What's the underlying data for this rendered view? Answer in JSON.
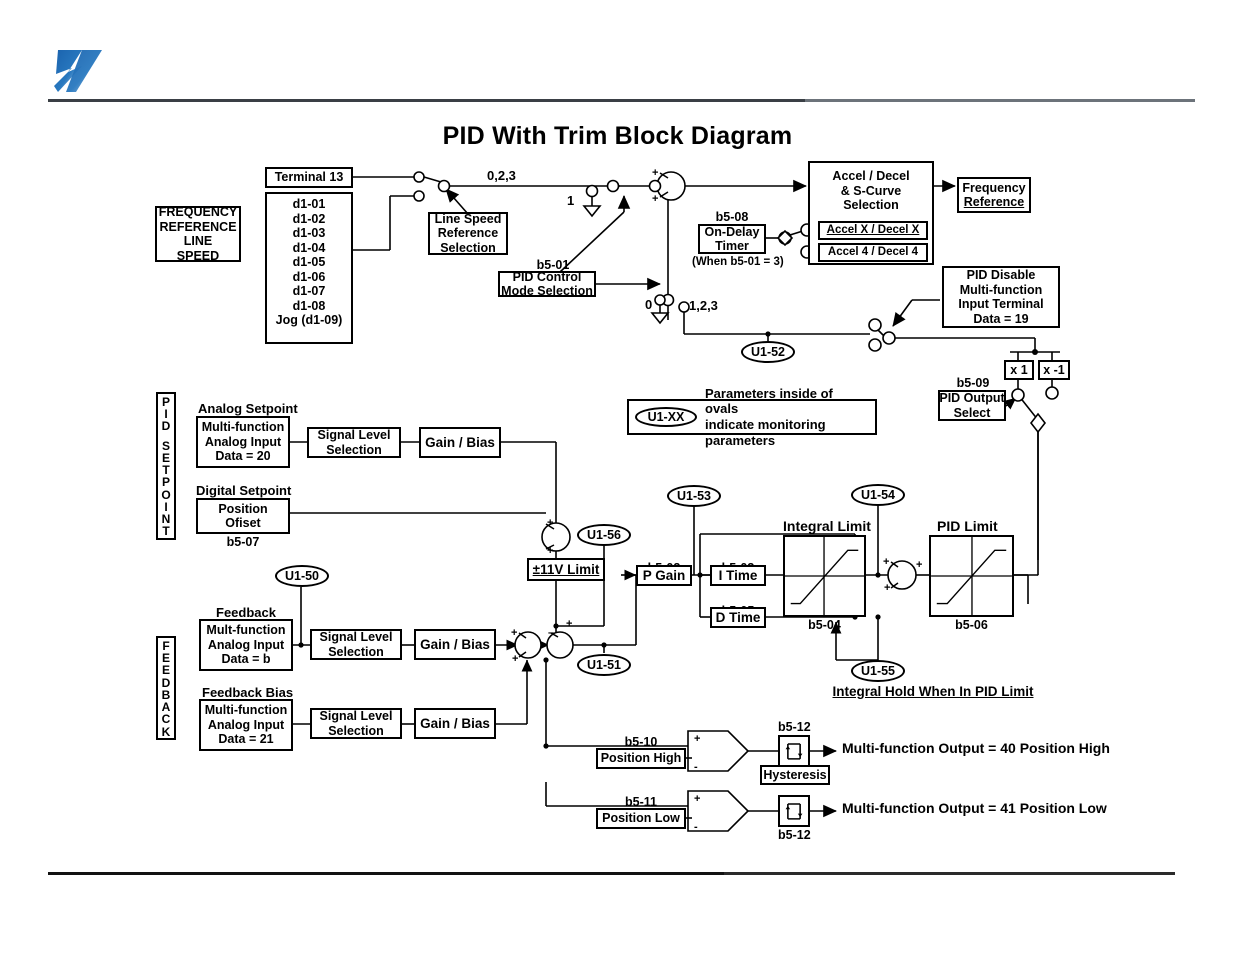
{
  "document": {
    "title": "PID With Trim Block Diagram",
    "logo_alt": "company-logo",
    "logo_color": "#1d6ab5"
  },
  "frequency_reference": {
    "side_label_lines": [
      "FREQUENCY",
      "REFERENCE",
      "LINE",
      "SPEED"
    ],
    "terminal": "Terminal 13",
    "d_params": [
      "d1-01",
      "d1-02",
      "d1-03",
      "d1-04",
      "d1-05",
      "d1-06",
      "d1-07",
      "d1-08",
      "Jog (d1-09)"
    ],
    "line_speed_selection": [
      "Line Speed",
      "Reference",
      "Selection"
    ]
  },
  "pid_control_mode": {
    "param": "b5-01",
    "label_lines": [
      "PID Control",
      "Mode Selection"
    ],
    "branch_023": "0,2,3",
    "branch_1": "1",
    "branch_0": "0",
    "branch_123": "1,2,3"
  },
  "accel_decel": {
    "title_lines": [
      "Accel / Decel",
      "& S-Curve",
      "Selection"
    ],
    "option_x": "Accel X / Decel X",
    "option_4": "Accel 4 / Decel 4",
    "output": [
      "Frequency",
      "Reference"
    ]
  },
  "on_delay_timer": {
    "param": "b5-08",
    "label_lines": [
      "On-Delay",
      "Timer"
    ],
    "condition": "(When  b5-01 = 3)"
  },
  "pid_disable": {
    "label_lines": [
      "PID Disable",
      "Multi-function",
      "Input Terminal",
      "Data = 19"
    ]
  },
  "pid_output_select": {
    "param": "b5-09",
    "label_lines": [
      "PID Output",
      "Select"
    ],
    "gain_positive": "x 1",
    "gain_negative": "x -1"
  },
  "setpoint": {
    "side_label": "PID SETPOINT",
    "side_letters": [
      "P",
      "I",
      "D",
      "",
      "S",
      "E",
      "T",
      "P",
      "O",
      "I",
      "N",
      "T"
    ],
    "analog": {
      "heading": "Analog Setpoint",
      "block_lines": [
        "Multi-function",
        "Analog Input",
        "Data = 20"
      ],
      "signal_level": [
        "Signal Level",
        "Selection"
      ],
      "gain_bias": "Gain / Bias"
    },
    "digital": {
      "heading": "Digital Setpoint",
      "block_lines": [
        "Position",
        "Ofiset"
      ],
      "param": "b5-07"
    },
    "limit_block": "±11V Limit"
  },
  "feedback": {
    "side_label": "FEEDBACK",
    "side_letters": [
      "F",
      "E",
      "E",
      "D",
      "B",
      "A",
      "C",
      "K"
    ],
    "main": {
      "heading": "Feedback",
      "block_lines": [
        "Mult-function",
        "Analog Input",
        "Data = b"
      ],
      "signal_level": [
        "Signal Level",
        "Selection"
      ],
      "gain_bias": "Gain / Bias"
    },
    "bias": {
      "heading": "Feedback Bias",
      "block_lines": [
        "Multi-function",
        "Analog Input",
        "Data = 21"
      ],
      "signal_level": [
        "Signal Level",
        "Selection"
      ],
      "gain_bias": "Gain / Bias"
    }
  },
  "pid_core": {
    "p_gain": {
      "param": "b5-02",
      "label": "P Gain"
    },
    "i_time": {
      "param": "b5-03",
      "label": "I Time"
    },
    "d_time": {
      "param": "b5-05",
      "label": "D Time"
    },
    "integral_limit": {
      "title": "Integral Limit",
      "param": "b5-04"
    },
    "pid_limit": {
      "title": "PID Limit",
      "param": "b5-06"
    },
    "integral_hold": "Integral Hold When In PID Limit"
  },
  "position_outputs": {
    "high": {
      "param": "b5-10",
      "label": "Position High",
      "hysteresis_param": "b5-12",
      "output_text": "Multi-function Output = 40 Position High",
      "plus": "+",
      "minus": "-"
    },
    "low": {
      "param": "b5-11",
      "label": "Position Low",
      "hysteresis_param": "b5-12",
      "output_text": "Multi-function Output = 41 Position Low",
      "plus": "+",
      "minus": "-"
    },
    "hysteresis_label": "Hysteresis"
  },
  "monitors": {
    "u1_50": "U1-50",
    "u1_51": "U1-51",
    "u1_52": "U1-52",
    "u1_53": "U1-53",
    "u1_54": "U1-54",
    "u1_55": "U1-55",
    "u1_56": "U1-56"
  },
  "legend": {
    "oval_text": "U1-XX",
    "line1": "Parameters inside of ovals",
    "line2": "indicate monitoring parameters"
  }
}
